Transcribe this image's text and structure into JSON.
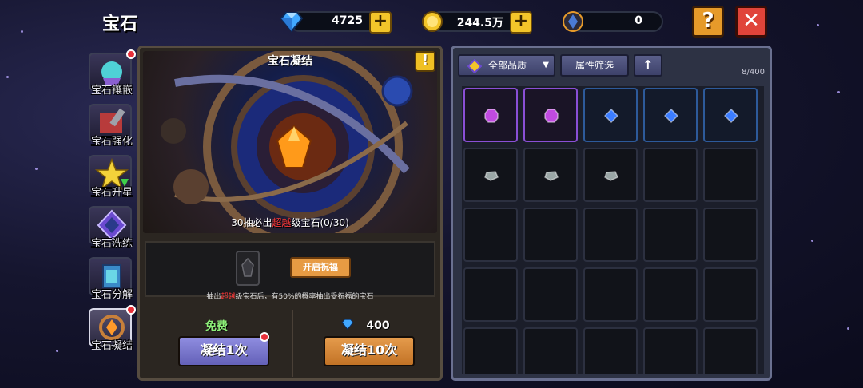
{
  "page_title": "宝石",
  "currencies": [
    {
      "icon": "diamond-icon",
      "amount": "4725",
      "has_plus": true
    },
    {
      "icon": "gold-coin-icon",
      "amount": "244.5万",
      "has_plus": true
    },
    {
      "icon": "crystal-token-icon",
      "amount": "0",
      "has_plus": false
    }
  ],
  "top_buttons": {
    "help": "?",
    "close": "✕"
  },
  "sidebar": {
    "items": [
      {
        "label": "宝石镶嵌",
        "icon": "gem-inlay-icon",
        "badge": true,
        "active": false
      },
      {
        "label": "宝石强化",
        "icon": "gem-enhance-icon",
        "badge": false,
        "active": false
      },
      {
        "label": "宝石升星",
        "icon": "gem-star-up-icon",
        "badge": false,
        "active": false
      },
      {
        "label": "宝石洗练",
        "icon": "gem-refine-icon",
        "badge": false,
        "active": false
      },
      {
        "label": "宝石分解",
        "icon": "gem-decompose-icon",
        "badge": false,
        "active": false
      },
      {
        "label": "宝石凝结",
        "icon": "gem-condense-icon",
        "badge": true,
        "active": true
      }
    ]
  },
  "condense": {
    "title": "宝石凝结",
    "warning_glyph": "!",
    "caption_prefix": "30抽必出",
    "caption_highlight": "超越",
    "caption_suffix": "级宝石(0/30)",
    "bless_button": "开启祝福",
    "note_prefix": "抽出",
    "note_highlight": "超越",
    "note_suffix": "级宝石后，有50%的概率抽出受祝福的宝石",
    "free_label": "免费",
    "draw_one": "凝结1次",
    "draw_one_badge": true,
    "cost_amount": "400",
    "draw_ten": "凝结10次"
  },
  "inventory": {
    "filter_quality": "全部品质",
    "filter_attr": "属性筛选",
    "sort_glyph": "↑",
    "count": "8/400",
    "items": [
      {
        "quality": "purple",
        "gem": "purple-gem"
      },
      {
        "quality": "purple",
        "gem": "purple-gem"
      },
      {
        "quality": "blue",
        "gem": "blue-gem"
      },
      {
        "quality": "blue",
        "gem": "blue-gem"
      },
      {
        "quality": "blue",
        "gem": "blue-gem"
      },
      {
        "quality": "none",
        "gem": "gray-gem"
      },
      {
        "quality": "none",
        "gem": "gray-gem"
      },
      {
        "quality": "none",
        "gem": "gray-gem"
      }
    ]
  },
  "colors": {
    "diamond": "#41a8ff",
    "gold": "#f3c52a",
    "purple_gem": "#c04be0",
    "blue_gem": "#3c7dff",
    "gray_gem": "#9aa6a6",
    "highlight_red": "#ff3838",
    "free_green": "#8ef07a"
  }
}
